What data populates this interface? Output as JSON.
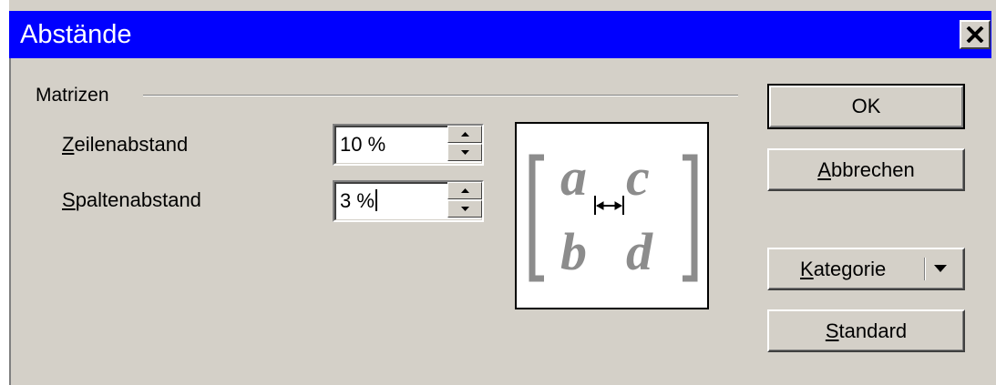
{
  "window": {
    "title": "Abstände"
  },
  "group": {
    "label": "Matrizen"
  },
  "fields": [
    {
      "label_mnemonic": "Z",
      "label_rest": "eilenabstand",
      "value": "10 %"
    },
    {
      "label_mnemonic": "S",
      "label_rest": "paltenabstand",
      "value": "3 %"
    }
  ],
  "preview": {
    "a": "a",
    "b": "b",
    "c": "c",
    "d": "d"
  },
  "buttons": {
    "ok": "OK",
    "cancel_mnemonic": "A",
    "cancel_rest": "bbrechen",
    "category_mnemonic": "K",
    "category_rest": "ategorie",
    "default_mnemonic": "S",
    "default_rest": "tandard"
  },
  "colors": {
    "titlebar": "#0000ff",
    "dialog": "#d4d0c8",
    "preview_glyphs": "#8c8c8c"
  },
  "icons": {
    "close": "close-icon",
    "spin_up": "arrow-up-icon",
    "spin_down": "arrow-down-icon",
    "dropdown": "dropdown-arrow-icon",
    "spacing": "column-spacing-arrow-icon"
  }
}
